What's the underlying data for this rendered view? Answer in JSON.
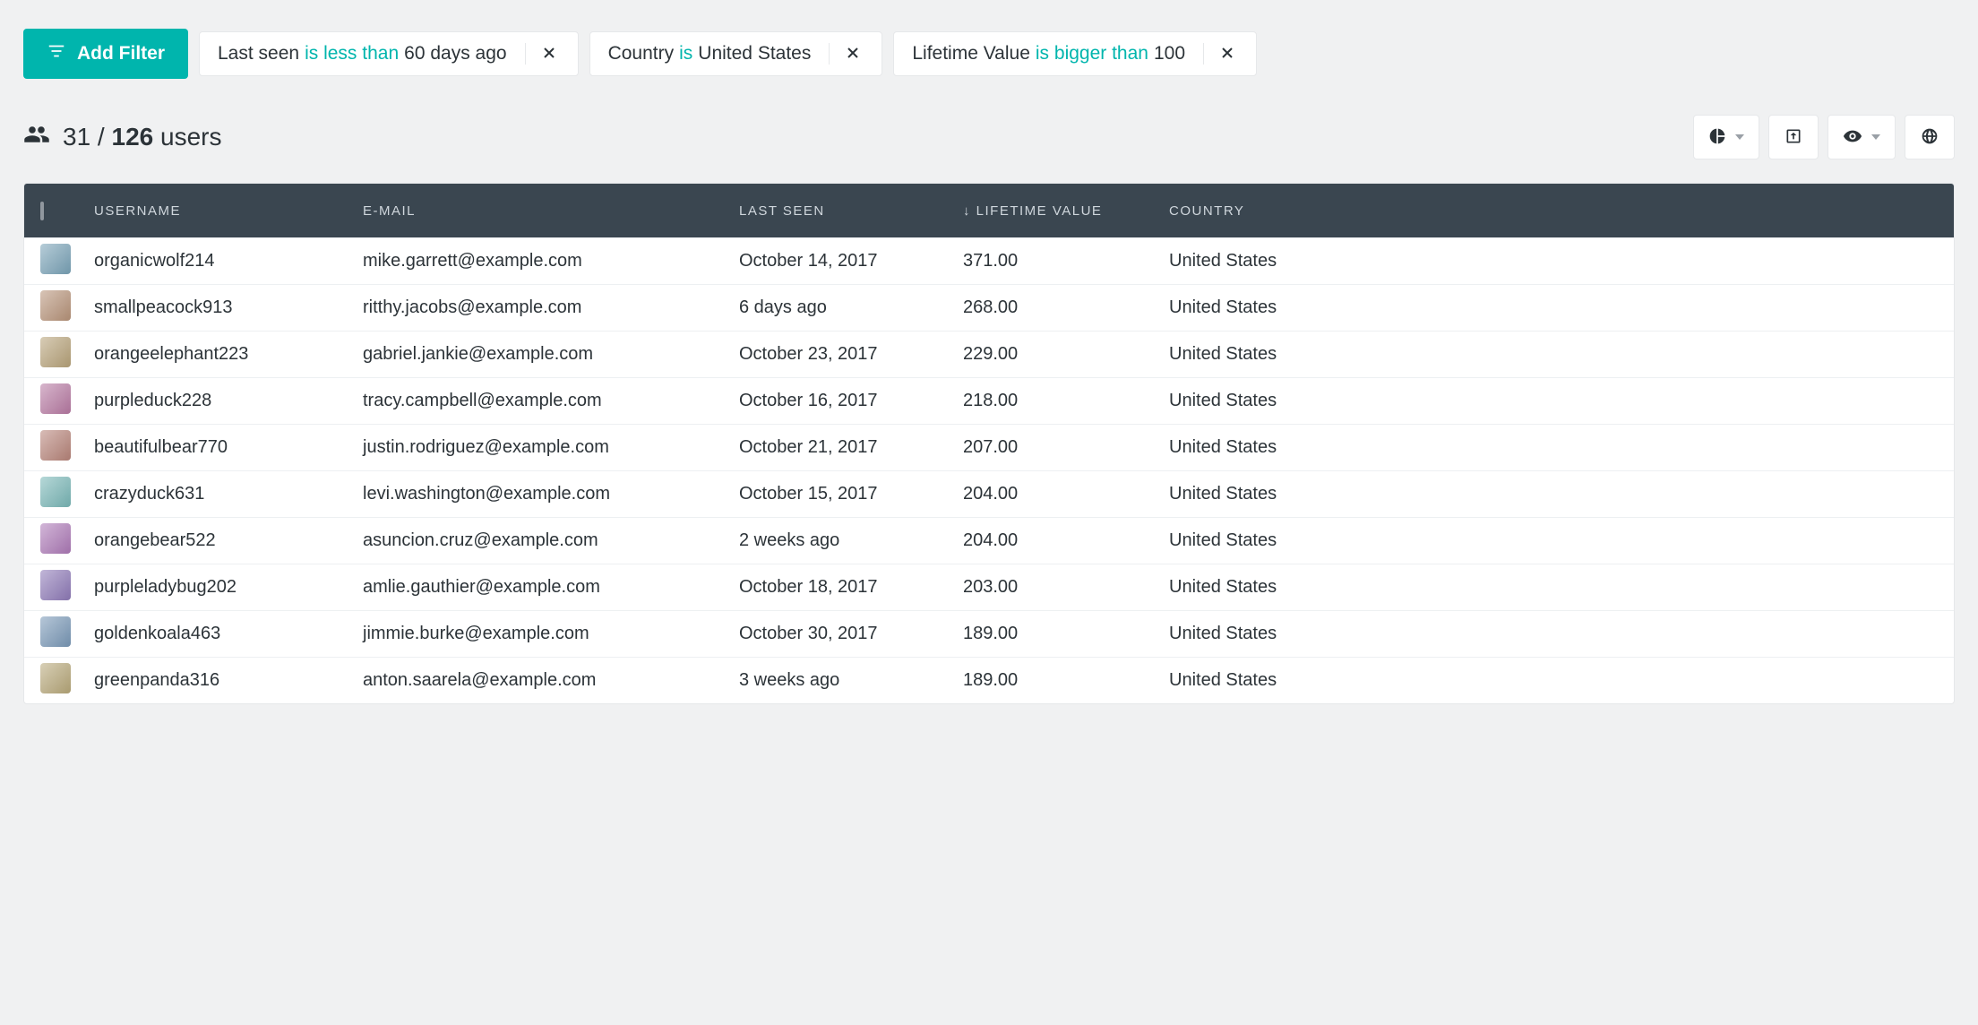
{
  "filters": {
    "add_label": "Add Filter",
    "chips": [
      {
        "field": "Last seen",
        "op": "is less than",
        "value": "60 days ago"
      },
      {
        "field": "Country",
        "op": "is",
        "value": "United States"
      },
      {
        "field": "Lifetime Value",
        "op": "is bigger than",
        "value": "100"
      }
    ]
  },
  "count": {
    "matching": "31",
    "sep": " / ",
    "total": "126",
    "suffix": " users"
  },
  "table": {
    "columns": {
      "username": "Username",
      "email": "E-mail",
      "last_seen": "Last seen",
      "lifetime_value": "Lifetime value",
      "country": "Country"
    },
    "sort_column": "lifetime_value",
    "rows": [
      {
        "username": "organicwolf214",
        "email": "mike.garrett@example.com",
        "last_seen": "October 14, 2017",
        "lifetime_value": "371.00",
        "country": "United States"
      },
      {
        "username": "smallpeacock913",
        "email": "ritthy.jacobs@example.com",
        "last_seen": "6 days ago",
        "lifetime_value": "268.00",
        "country": "United States"
      },
      {
        "username": "orangeelephant223",
        "email": "gabriel.jankie@example.com",
        "last_seen": "October 23, 2017",
        "lifetime_value": "229.00",
        "country": "United States"
      },
      {
        "username": "purpleduck228",
        "email": "tracy.campbell@example.com",
        "last_seen": "October 16, 2017",
        "lifetime_value": "218.00",
        "country": "United States"
      },
      {
        "username": "beautifulbear770",
        "email": "justin.rodriguez@example.com",
        "last_seen": "October 21, 2017",
        "lifetime_value": "207.00",
        "country": "United States"
      },
      {
        "username": "crazyduck631",
        "email": "levi.washington@example.com",
        "last_seen": "October 15, 2017",
        "lifetime_value": "204.00",
        "country": "United States"
      },
      {
        "username": "orangebear522",
        "email": "asuncion.cruz@example.com",
        "last_seen": "2 weeks ago",
        "lifetime_value": "204.00",
        "country": "United States"
      },
      {
        "username": "purpleladybug202",
        "email": "amlie.gauthier@example.com",
        "last_seen": "October 18, 2017",
        "lifetime_value": "203.00",
        "country": "United States"
      },
      {
        "username": "goldenkoala463",
        "email": "jimmie.burke@example.com",
        "last_seen": "October 30, 2017",
        "lifetime_value": "189.00",
        "country": "United States"
      },
      {
        "username": "greenpanda316",
        "email": "anton.saarela@example.com",
        "last_seen": "3 weeks ago",
        "lifetime_value": "189.00",
        "country": "United States"
      }
    ]
  }
}
